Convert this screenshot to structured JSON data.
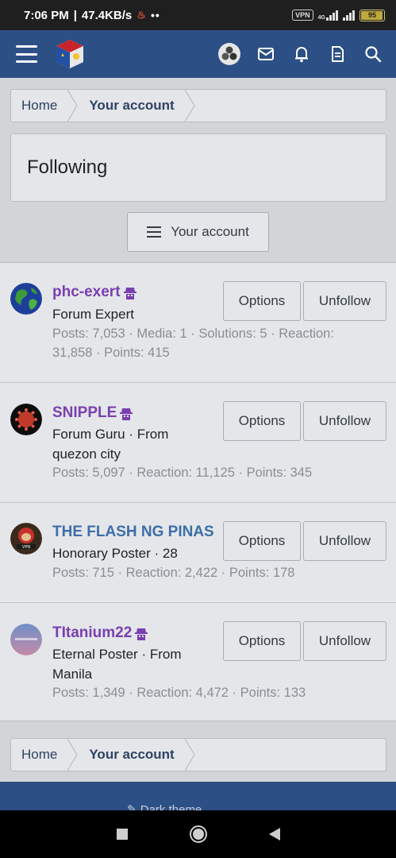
{
  "status_bar": {
    "time": "7:06 PM",
    "speed": "47.4KB/s",
    "dots": "••",
    "vpn": "VPN",
    "network": "4G",
    "battery": "95",
    "battery_level": 0.95
  },
  "breadcrumb_top": {
    "home": "Home",
    "account": "Your account"
  },
  "page_title": "Following",
  "account_button": "Your account",
  "members": [
    {
      "name": "phc-exert",
      "name_color": "#7a3fb0",
      "staff_icon": true,
      "role": "Forum Expert",
      "stats": "Posts: 7,053 · Media: 1 · Solutions: 5 · Reaction: 31,858 · Points: 415",
      "options_label": "Options",
      "unfollow_label": "Unfollow",
      "avatar_icon": "earth-globe-avatar"
    },
    {
      "name": "SNIPPLE",
      "name_color": "#7a3fb0",
      "staff_icon": true,
      "role": "Forum Guru · From quezon city",
      "stats": "Posts: 5,097 · Reaction: 11,125 · Points: 345",
      "options_label": "Options",
      "unfollow_label": "Unfollow",
      "avatar_icon": "virus-avatar"
    },
    {
      "name": "THE FLASH NG PINAS",
      "name_color": "#3d6ea8",
      "staff_icon": false,
      "role": "Honorary Poster · 28",
      "stats": "Posts: 715 · Reaction: 2,422 · Points: 178",
      "options_label": "Options",
      "unfollow_label": "Unfollow",
      "avatar_icon": "flash-vpn-avatar"
    },
    {
      "name": "TItanium22",
      "name_color": "#7a3fb0",
      "staff_icon": true,
      "role": "Eternal Poster · From Manila",
      "stats": "Posts: 1,349 · Reaction: 4,472 · Points: 133",
      "options_label": "Options",
      "unfollow_label": "Unfollow",
      "avatar_icon": "sky-avatar"
    }
  ],
  "breadcrumb_bottom": {
    "home": "Home",
    "account": "Your account"
  },
  "footer": {
    "style_label": "Dark theme"
  },
  "colors": {
    "header_bg": "#2c4f85",
    "page_bg": "#d2d4d7",
    "panel_bg": "#e4e6e9",
    "link_text": "#2f4264",
    "staff_purple": "#7a3fb0"
  }
}
